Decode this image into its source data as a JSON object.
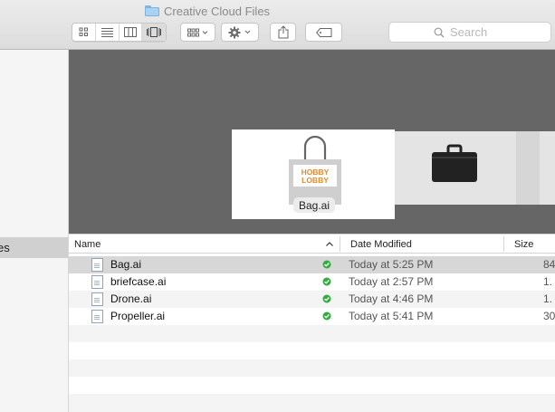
{
  "window": {
    "title": "Creative Cloud Files"
  },
  "search": {
    "placeholder": "Search"
  },
  "sidebar": {
    "selected_item_label": "es"
  },
  "preview": {
    "selected_file_label": "Bag.ai"
  },
  "list": {
    "columns": {
      "name": "Name",
      "date": "Date Modified",
      "size": "Size"
    },
    "sort": "name-ascending",
    "rows": [
      {
        "name": "Bag.ai",
        "date": "Today at 5:25 PM",
        "size": "84"
      },
      {
        "name": "briefcase.ai",
        "date": "Today at 2:57 PM",
        "size": "1."
      },
      {
        "name": "Drone.ai",
        "date": "Today at 4:46 PM",
        "size": "1."
      },
      {
        "name": "Propeller.ai",
        "date": "Today at 5:41 PM",
        "size": "30"
      }
    ]
  },
  "colors": {
    "sync_ok": "#2fae3d",
    "preview_bg": "#666666",
    "bag_orange": "#e48a2e"
  }
}
